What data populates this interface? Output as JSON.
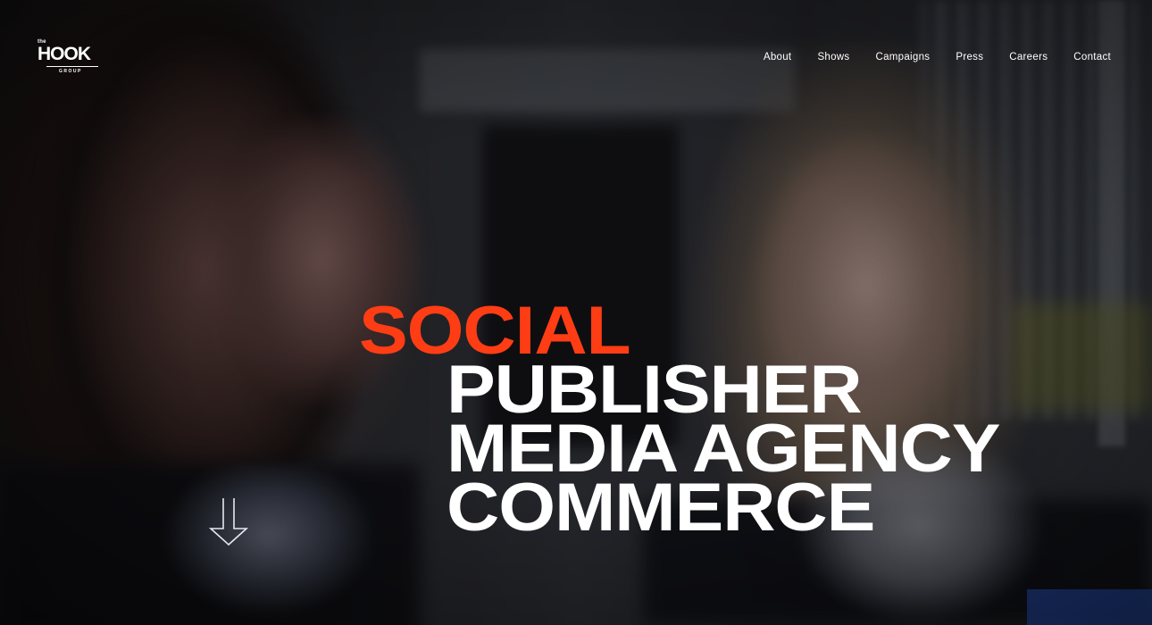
{
  "brand": {
    "logo_small": "the",
    "logo_main": "HOOK",
    "logo_sub": "GROUP"
  },
  "nav": {
    "items": [
      "About",
      "Shows",
      "Campaigns",
      "Press",
      "Careers",
      "Contact"
    ]
  },
  "hero": {
    "highlight": "SOCIAL",
    "lines": [
      "PUBLISHER",
      "MEDIA AGENCY",
      "COMMERCE"
    ],
    "scroll_icon": "arrow-down-icon"
  },
  "colors": {
    "accent": "#ff3d14",
    "text": "#ffffff"
  }
}
